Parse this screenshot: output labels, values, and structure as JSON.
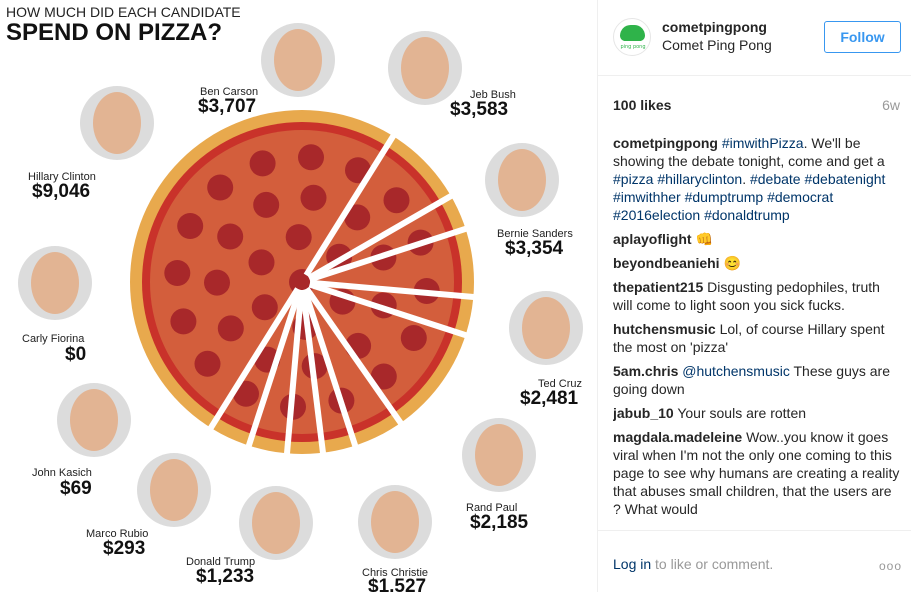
{
  "image": {
    "title_line1": "HOW MUCH DID EACH CANDIDATE",
    "title_line2": "SPEND ON PIZZA?",
    "candidates": [
      {
        "name": "Ben Carson",
        "amount": "$3,707"
      },
      {
        "name": "Jeb Bush",
        "amount": "$3,583"
      },
      {
        "name": "Hillary Clinton",
        "amount": "$9,046"
      },
      {
        "name": "Bernie Sanders",
        "amount": "$3,354"
      },
      {
        "name": "Carly Fiorina",
        "amount": "$0"
      },
      {
        "name": "Ted Cruz",
        "amount": "$2,481"
      },
      {
        "name": "John Kasich",
        "amount": "$69"
      },
      {
        "name": "Rand Paul",
        "amount": "$2,185"
      },
      {
        "name": "Marco Rubio",
        "amount": "$293"
      },
      {
        "name": "Donald Trump",
        "amount": "$1,233"
      },
      {
        "name": "Chris Christie",
        "amount": "$1,527"
      }
    ]
  },
  "header": {
    "username": "cometpingpong",
    "full_name": "Comet Ping Pong",
    "follow_label": "Follow",
    "avatar_caption": "ping pong"
  },
  "stats": {
    "likes": "100 likes",
    "time": "6w"
  },
  "caption": {
    "user": "cometpingpong",
    "parts": [
      {
        "t": "#imwithPizza",
        "tag": true
      },
      {
        "t": ". We'll be showing the debate tonight, come and get a ",
        "tag": false
      },
      {
        "t": "#pizza",
        "tag": true
      },
      {
        "t": " ",
        "tag": false
      },
      {
        "t": "#hillaryclinton",
        "tag": true
      },
      {
        "t": ". ",
        "tag": false
      },
      {
        "t": "#debate",
        "tag": true
      },
      {
        "t": " ",
        "tag": false
      },
      {
        "t": "#debatenight",
        "tag": true
      },
      {
        "t": " ",
        "tag": false
      },
      {
        "t": "#imwithher",
        "tag": true
      },
      {
        "t": " ",
        "tag": false
      },
      {
        "t": "#dumptrump",
        "tag": true
      },
      {
        "t": " ",
        "tag": false
      },
      {
        "t": "#democrat",
        "tag": true
      },
      {
        "t": " ",
        "tag": false
      },
      {
        "t": "#2016election",
        "tag": true
      },
      {
        "t": " ",
        "tag": false
      },
      {
        "t": "#donaldtrump",
        "tag": true
      }
    ]
  },
  "comments": [
    {
      "user": "aplayoflight",
      "text": "👊"
    },
    {
      "user": "beyondbeaniehi",
      "text": "😊"
    },
    {
      "user": "thepatient215",
      "text": "Disgusting pedophiles, truth will come to light soon you sick fucks."
    },
    {
      "user": "hutchensmusic",
      "text": "Lol, of course Hillary spent the most on 'pizza'"
    },
    {
      "user": "5am.chris",
      "mention": "@hutchensmusic",
      "text": "These guys are going down"
    },
    {
      "user": "jabub_10",
      "text": "Your souls are rotten"
    },
    {
      "user": "magdala.madeleine",
      "text": "Wow..you know it goes viral when I'm not the only one coming to this page to see why humans are creating a reality that abuses small children, that the users are ? What would"
    }
  ],
  "footer": {
    "login_label": "Log in",
    "login_suffix": " to like or comment.",
    "more_label": "ooo"
  },
  "colors": {
    "follow": "#3897f0",
    "hashtag": "#003569",
    "crust": "#e8a94d",
    "sauce": "#c9322a",
    "pepperoni": "#a8282a"
  }
}
